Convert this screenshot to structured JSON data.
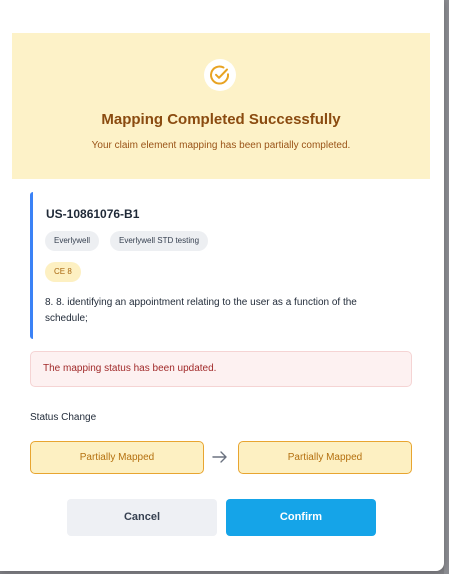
{
  "banner": {
    "icon": "check-circle-icon",
    "title": "Mapping Completed Successfully",
    "subtitle": "Your claim element mapping has been partially completed."
  },
  "detail": {
    "reference_id": "US-10861076-B1",
    "tags": [
      "Everlywell",
      "Everlywell STD testing"
    ],
    "claim_element_tag": "CE 8",
    "element_text": "8. 8. identifying an appointment relating to the user as a function of the schedule;"
  },
  "alert": {
    "message": "The mapping status has been updated."
  },
  "status_change": {
    "label": "Status Change",
    "from": "Partially Mapped",
    "to": "Partially Mapped",
    "arrow_icon": "arrow-right-icon"
  },
  "actions": {
    "cancel_label": "Cancel",
    "confirm_label": "Confirm"
  },
  "colors": {
    "accent": "#15a4e8",
    "banner_bg": "#fdf2c8",
    "title": "#8a4b10",
    "card_border": "#3b82f6",
    "status_border": "#e8a530",
    "alert_text": "#a12a2a"
  }
}
